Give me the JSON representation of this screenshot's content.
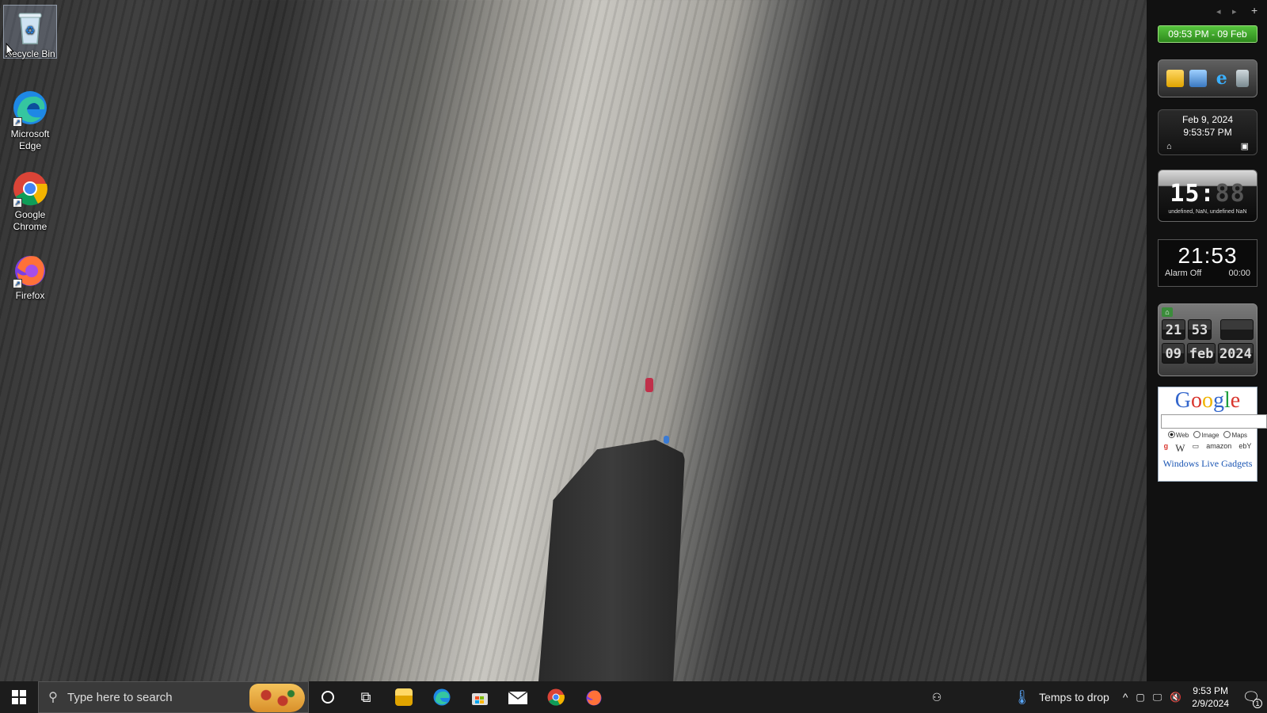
{
  "desktop": {
    "icons": [
      {
        "label": "Recycle Bin"
      },
      {
        "label": "Microsoft Edge"
      },
      {
        "label": "Google Chrome"
      },
      {
        "label": "Firefox"
      }
    ]
  },
  "sidebar": {
    "controls": {
      "prev": "◂",
      "next": "▸",
      "add": "+"
    },
    "time_banner": "09:53 PM - 09 Feb",
    "datetime": {
      "date": "Feb 9, 2024",
      "time": "9:53:57 PM"
    },
    "digital_clock": {
      "hours": "15",
      "sep": ":",
      "minutes": "88",
      "subtext": "undefined, NaN, undefined NaN"
    },
    "alarm_clock": {
      "time": "21:53",
      "status": "Alarm Off",
      "alarm_time": "00:00"
    },
    "flip_clock": {
      "hour": "21",
      "minute": "53",
      "day": "09",
      "month": "feb",
      "year": "2024"
    },
    "google_gadget": {
      "logo": "Google",
      "search_value": "",
      "radios": [
        {
          "label": "Web",
          "selected": true
        },
        {
          "label": "Image",
          "selected": false
        },
        {
          "label": "Maps",
          "selected": false
        }
      ],
      "links": [
        "W",
        "amazon",
        "ebY"
      ],
      "footer": "Windows Live Gadgets"
    }
  },
  "taskbar": {
    "search_placeholder": "Type here to search",
    "weather": "Temps to drop",
    "clock_time": "9:53 PM",
    "clock_date": "2/9/2024",
    "notification_count": "1"
  }
}
